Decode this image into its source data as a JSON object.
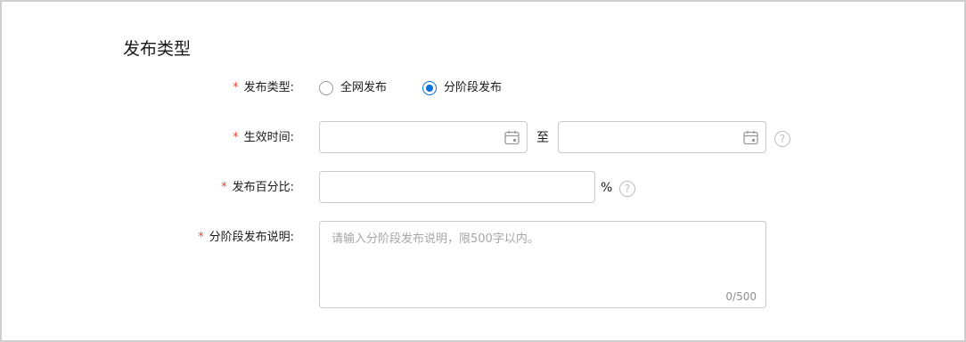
{
  "section": {
    "title": "发布类型"
  },
  "form": {
    "required_mark": "*",
    "release_type": {
      "label": "发布类型:",
      "options": [
        {
          "label": "全网发布",
          "checked": false
        },
        {
          "label": "分阶段发布",
          "checked": true
        }
      ]
    },
    "effective_time": {
      "label": "生效时间:",
      "start_value": "",
      "separator": "至",
      "end_value": "",
      "help_icon": "question-circle-icon",
      "calendar_icon": "calendar-icon"
    },
    "release_percent": {
      "label": "发布百分比:",
      "value": "",
      "unit": "%",
      "help_icon": "question-circle-icon"
    },
    "description": {
      "label": "分阶段发布说明:",
      "placeholder": "请输入分阶段发布说明，限500字以内。",
      "counter": "0/500"
    }
  },
  "colors": {
    "accent": "#0a6fd8",
    "required": "#e8483c",
    "border": "#c9c9c9"
  }
}
